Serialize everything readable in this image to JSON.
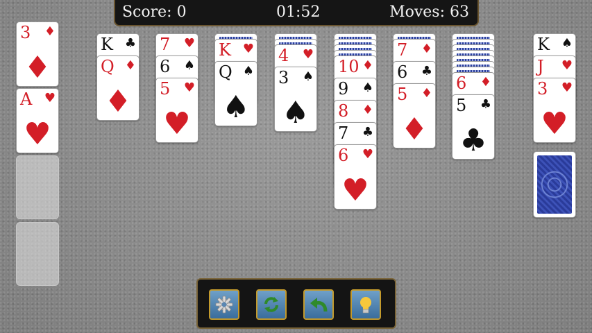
{
  "topbar": {
    "score": "Score: 0",
    "time": "01:52",
    "moves": "Moves: 63"
  },
  "colors": {
    "red": "#d31e27",
    "black": "#111111",
    "table": "#8d8d8d",
    "card_back": "#2a3b9a",
    "toolbar_border": "#c39a2c"
  },
  "foundations": [
    {
      "rank": "3",
      "suit": "♦",
      "color": "red"
    },
    {
      "rank": "A",
      "suit": "♥",
      "color": "red"
    }
  ],
  "foundation_empty_slots": 2,
  "tableau": [
    {
      "hidden": 0,
      "cards": [
        {
          "rank": "K",
          "suit": "♣",
          "color": "black"
        },
        {
          "rank": "Q",
          "suit": "♦",
          "color": "red"
        }
      ]
    },
    {
      "hidden": 0,
      "cards": [
        {
          "rank": "7",
          "suit": "♥",
          "color": "red"
        },
        {
          "rank": "6",
          "suit": "♠",
          "color": "black"
        },
        {
          "rank": "5",
          "suit": "♥",
          "color": "red"
        }
      ]
    },
    {
      "hidden": 1,
      "cards": [
        {
          "rank": "K",
          "suit": "♥",
          "color": "red"
        },
        {
          "rank": "Q",
          "suit": "♠",
          "color": "black"
        }
      ]
    },
    {
      "hidden": 2,
      "cards": [
        {
          "rank": "4",
          "suit": "♥",
          "color": "red"
        },
        {
          "rank": "3",
          "suit": "♠",
          "color": "black"
        }
      ]
    },
    {
      "hidden": 4,
      "cards": [
        {
          "rank": "10",
          "suit": "♦",
          "color": "red"
        },
        {
          "rank": "9",
          "suit": "♠",
          "color": "black"
        },
        {
          "rank": "8",
          "suit": "♦",
          "color": "red"
        },
        {
          "rank": "7",
          "suit": "♣",
          "color": "black"
        },
        {
          "rank": "6",
          "suit": "♥",
          "color": "red"
        }
      ]
    },
    {
      "hidden": 1,
      "cards": [
        {
          "rank": "7",
          "suit": "♦",
          "color": "red"
        },
        {
          "rank": "6",
          "suit": "♣",
          "color": "black"
        },
        {
          "rank": "5",
          "suit": "♦",
          "color": "red"
        }
      ]
    },
    {
      "hidden": 7,
      "cards": [
        {
          "rank": "6",
          "suit": "♦",
          "color": "red"
        },
        {
          "rank": "5",
          "suit": "♣",
          "color": "black"
        }
      ]
    }
  ],
  "waste": [
    {
      "rank": "K",
      "suit": "♠",
      "color": "black"
    },
    {
      "rank": "J",
      "suit": "♥",
      "color": "red"
    },
    {
      "rank": "3",
      "suit": "♥",
      "color": "red"
    }
  ],
  "stock": {
    "icon": "card-back-pattern"
  },
  "toolbar": [
    {
      "name": "settings-button",
      "icon": "gear-icon"
    },
    {
      "name": "new-game-button",
      "icon": "refresh-icon"
    },
    {
      "name": "undo-button",
      "icon": "undo-arrow-icon"
    },
    {
      "name": "hint-button",
      "icon": "lightbulb-icon"
    }
  ]
}
